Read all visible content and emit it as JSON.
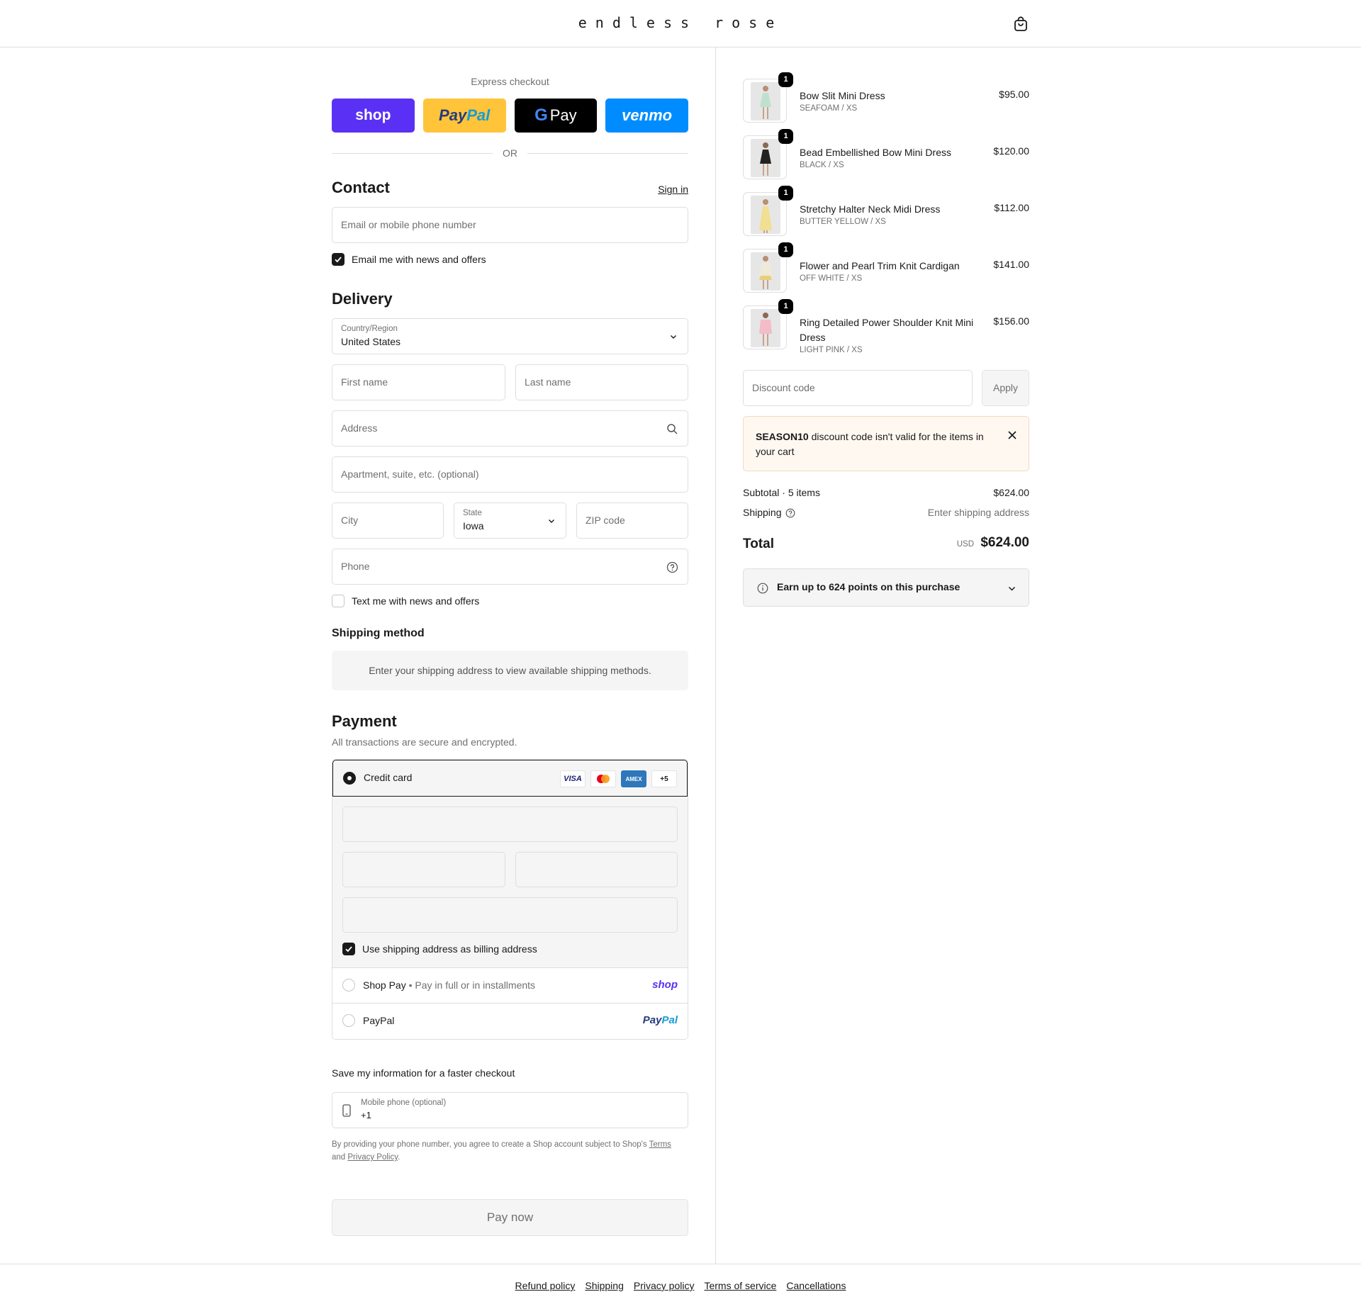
{
  "header": {
    "logo": "endless rose",
    "cart_icon": "shopping-bag-icon"
  },
  "express": {
    "title": "Express checkout",
    "buttons": {
      "shop": "shop",
      "paypal_a": "Pay",
      "paypal_b": "Pal",
      "gpay_g": "G",
      "gpay": "Pay",
      "venmo": "venmo"
    },
    "or": "OR"
  },
  "contact": {
    "heading": "Contact",
    "sign_in": "Sign in",
    "email_placeholder": "Email or mobile phone number",
    "news_checkbox": "Email me with news and offers",
    "news_checked": true
  },
  "delivery": {
    "heading": "Delivery",
    "country_label": "Country/Region",
    "country_value": "United States",
    "first_name": "First name",
    "last_name": "Last name",
    "address": "Address",
    "apartment": "Apartment, suite, etc. (optional)",
    "city": "City",
    "state_label": "State",
    "state_value": "Iowa",
    "zip": "ZIP code",
    "phone": "Phone",
    "text_checkbox": "Text me with news and offers",
    "text_checked": false
  },
  "shipping_method": {
    "heading": "Shipping method",
    "message": "Enter your shipping address to view available shipping methods."
  },
  "payment": {
    "heading": "Payment",
    "subtitle": "All transactions are secure and encrypted.",
    "credit_card": "Credit card",
    "badges": {
      "visa": "VISA",
      "amex": "AMEX",
      "more": "+5"
    },
    "billing_checkbox": "Use shipping address as billing address",
    "billing_checked": true,
    "shop_pay": "Shop Pay",
    "shop_pay_sub": "Pay in full or in installments",
    "shop_pay_brand": "shop",
    "paypal": "PayPal",
    "paypal_brand_a": "Pay",
    "paypal_brand_b": "Pal"
  },
  "save_info": {
    "heading": "Save my information for a faster checkout",
    "mobile_label": "Mobile phone (optional)",
    "mobile_value": "+1",
    "fine_print_a": "By providing your phone number, you agree to create a Shop account subject to Shop's ",
    "terms": "Terms",
    "fine_print_b": "and ",
    "privacy": "Privacy Policy",
    "fine_print_c": "."
  },
  "pay_now": "Pay now",
  "footer": {
    "links": [
      "Refund policy",
      "Shipping",
      "Privacy policy",
      "Terms of service",
      "Cancellations"
    ]
  },
  "summary": {
    "items": [
      {
        "qty": "1",
        "name": "Bow Slit Mini Dress",
        "variant": "SEAFOAM / XS",
        "price": "$95.00",
        "color": "#bfe0cf"
      },
      {
        "qty": "1",
        "name": "Bead Embellished Bow Mini Dress",
        "variant": "BLACK / XS",
        "price": "$120.00",
        "color": "#222222"
      },
      {
        "qty": "1",
        "name": "Stretchy Halter Neck Midi Dress",
        "variant": "BUTTER YELLOW / XS",
        "price": "$112.00",
        "color": "#f1df92"
      },
      {
        "qty": "1",
        "name": "Flower and Pearl Trim Knit Cardigan",
        "variant": "OFF WHITE / XS",
        "price": "$141.00",
        "color": "#efe9d8"
      },
      {
        "qty": "1",
        "name": "Ring Detailed Power Shoulder Knit Mini Dress",
        "variant": "LIGHT PINK / XS",
        "price": "$156.00",
        "color": "#f3bcc8"
      }
    ],
    "discount_placeholder": "Discount code",
    "apply": "Apply",
    "notice_code": "SEASON10",
    "notice_text": " discount code isn't valid for the items in your cart",
    "subtotal_label": "Subtotal · 5 items",
    "subtotal_value": "$624.00",
    "shipping_label": "Shipping",
    "shipping_value": "Enter shipping address",
    "total_label": "Total",
    "total_currency": "USD",
    "total_value": "$624.00",
    "points": "Earn up to 624 points on this purchase"
  },
  "colors": {
    "shop_purple": "#5a31f4",
    "paypal_yellow": "#ffc439",
    "venmo_blue": "#008cff",
    "notice_bg": "#fff8f1"
  }
}
